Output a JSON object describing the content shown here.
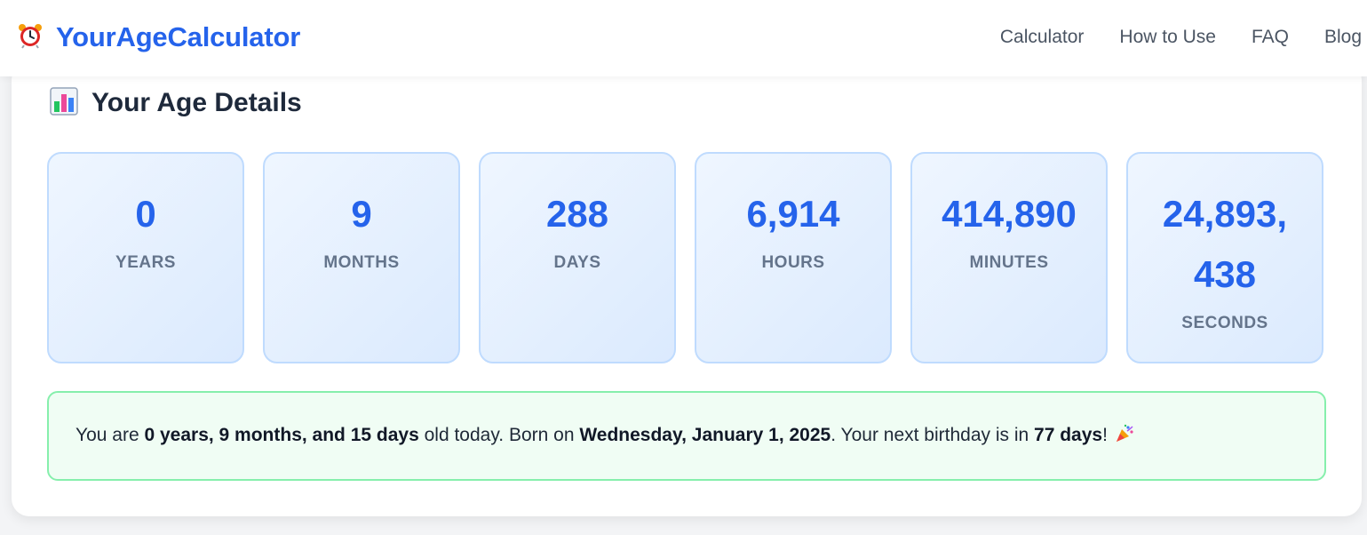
{
  "header": {
    "brand": "YourAgeCalculator",
    "brand_icon": "alarm-clock-icon",
    "nav": [
      "Calculator",
      "How to Use",
      "FAQ",
      "Blog"
    ]
  },
  "section": {
    "icon": "bar-chart-icon",
    "title": "Your Age Details"
  },
  "stats": [
    {
      "value": "0",
      "label": "YEARS"
    },
    {
      "value": "9",
      "label": "MONTHS"
    },
    {
      "value": "288",
      "label": "DAYS"
    },
    {
      "value": "6,914",
      "label": "HOURS"
    },
    {
      "value": "414,890",
      "label": "MINUTES"
    },
    {
      "value": "24,893,438",
      "label": "SECONDS"
    }
  ],
  "summary": {
    "p1": "You are ",
    "age": "0 years, 9 months, and 15 days",
    "p2": " old today. Born on ",
    "born": "Wednesday, January 1, 2025",
    "p3": ". Your next birthday is in ",
    "next": "77 days",
    "p4": "! ",
    "icon": "party-popper-icon"
  },
  "colors": {
    "brand": "#2563eb",
    "stat_value": "#2563eb",
    "summary_border": "#86efac",
    "summary_bg": "#f0fdf4"
  }
}
